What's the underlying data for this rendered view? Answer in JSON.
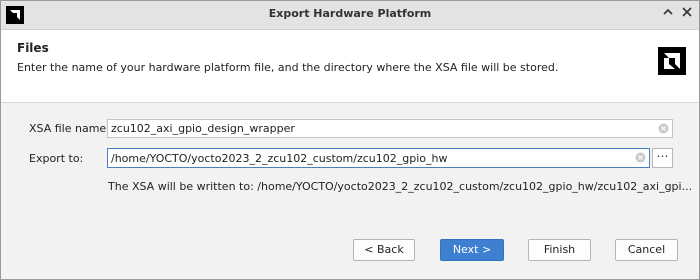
{
  "window": {
    "title": "Export Hardware Platform"
  },
  "header": {
    "title": "Files",
    "description": "Enter the name of your hardware platform file, and the directory where the XSA file will be stored."
  },
  "form": {
    "xsa_label": "XSA file name:",
    "xsa_value": "zcu102_axi_gpio_design_wrapper",
    "export_label": "Export to:",
    "export_value": "/home/YOCTO/yocto2023_2_zcu102_custom/zcu102_gpio_hw",
    "browse_label": "⋯",
    "info": "The XSA will be written to: /home/YOCTO/yocto2023_2_zcu102_custom/zcu102_gpio_hw/zcu102_axi_gpi..."
  },
  "buttons": {
    "back": "< Back",
    "next": "Next >",
    "finish": "Finish",
    "cancel": "Cancel"
  },
  "colors": {
    "primary_button": "#3d7fd0",
    "focus_border": "#4a7fc1"
  },
  "icons": {
    "titlebar_chevron": "chevron-up-icon",
    "titlebar_close": "close-icon",
    "field_clear": "clear-circle-icon"
  }
}
